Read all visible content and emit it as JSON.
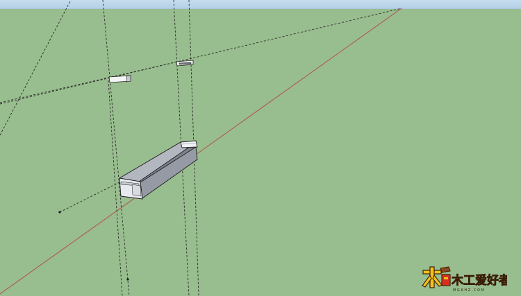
{
  "app": {
    "name": "SketchUp 3D modeling viewport"
  },
  "scene": {
    "colors": {
      "ground": "#98bd8e",
      "sky": "#c0d8ec",
      "red_axis": "#b0524a",
      "guide_line": "#2a2a2a",
      "model_face": "#8f949e",
      "model_face_light": "#b8bdc6",
      "model_end": "#e8ecef",
      "edge": "#1e1e1e"
    },
    "objects": {
      "rail_model": "long hollow rectangular rail component",
      "bracket_left": "small white bracket component",
      "bracket_right": "small white bracket component",
      "guide_point_a": "guide point",
      "guide_point_b": "guide point"
    }
  },
  "watermark": {
    "text": "木工爱好者",
    "url_text": "M G A H Z . C O M",
    "colors": {
      "fill": "#f5c21b",
      "red": "#d9301e",
      "outline": "#3a1d08"
    }
  }
}
